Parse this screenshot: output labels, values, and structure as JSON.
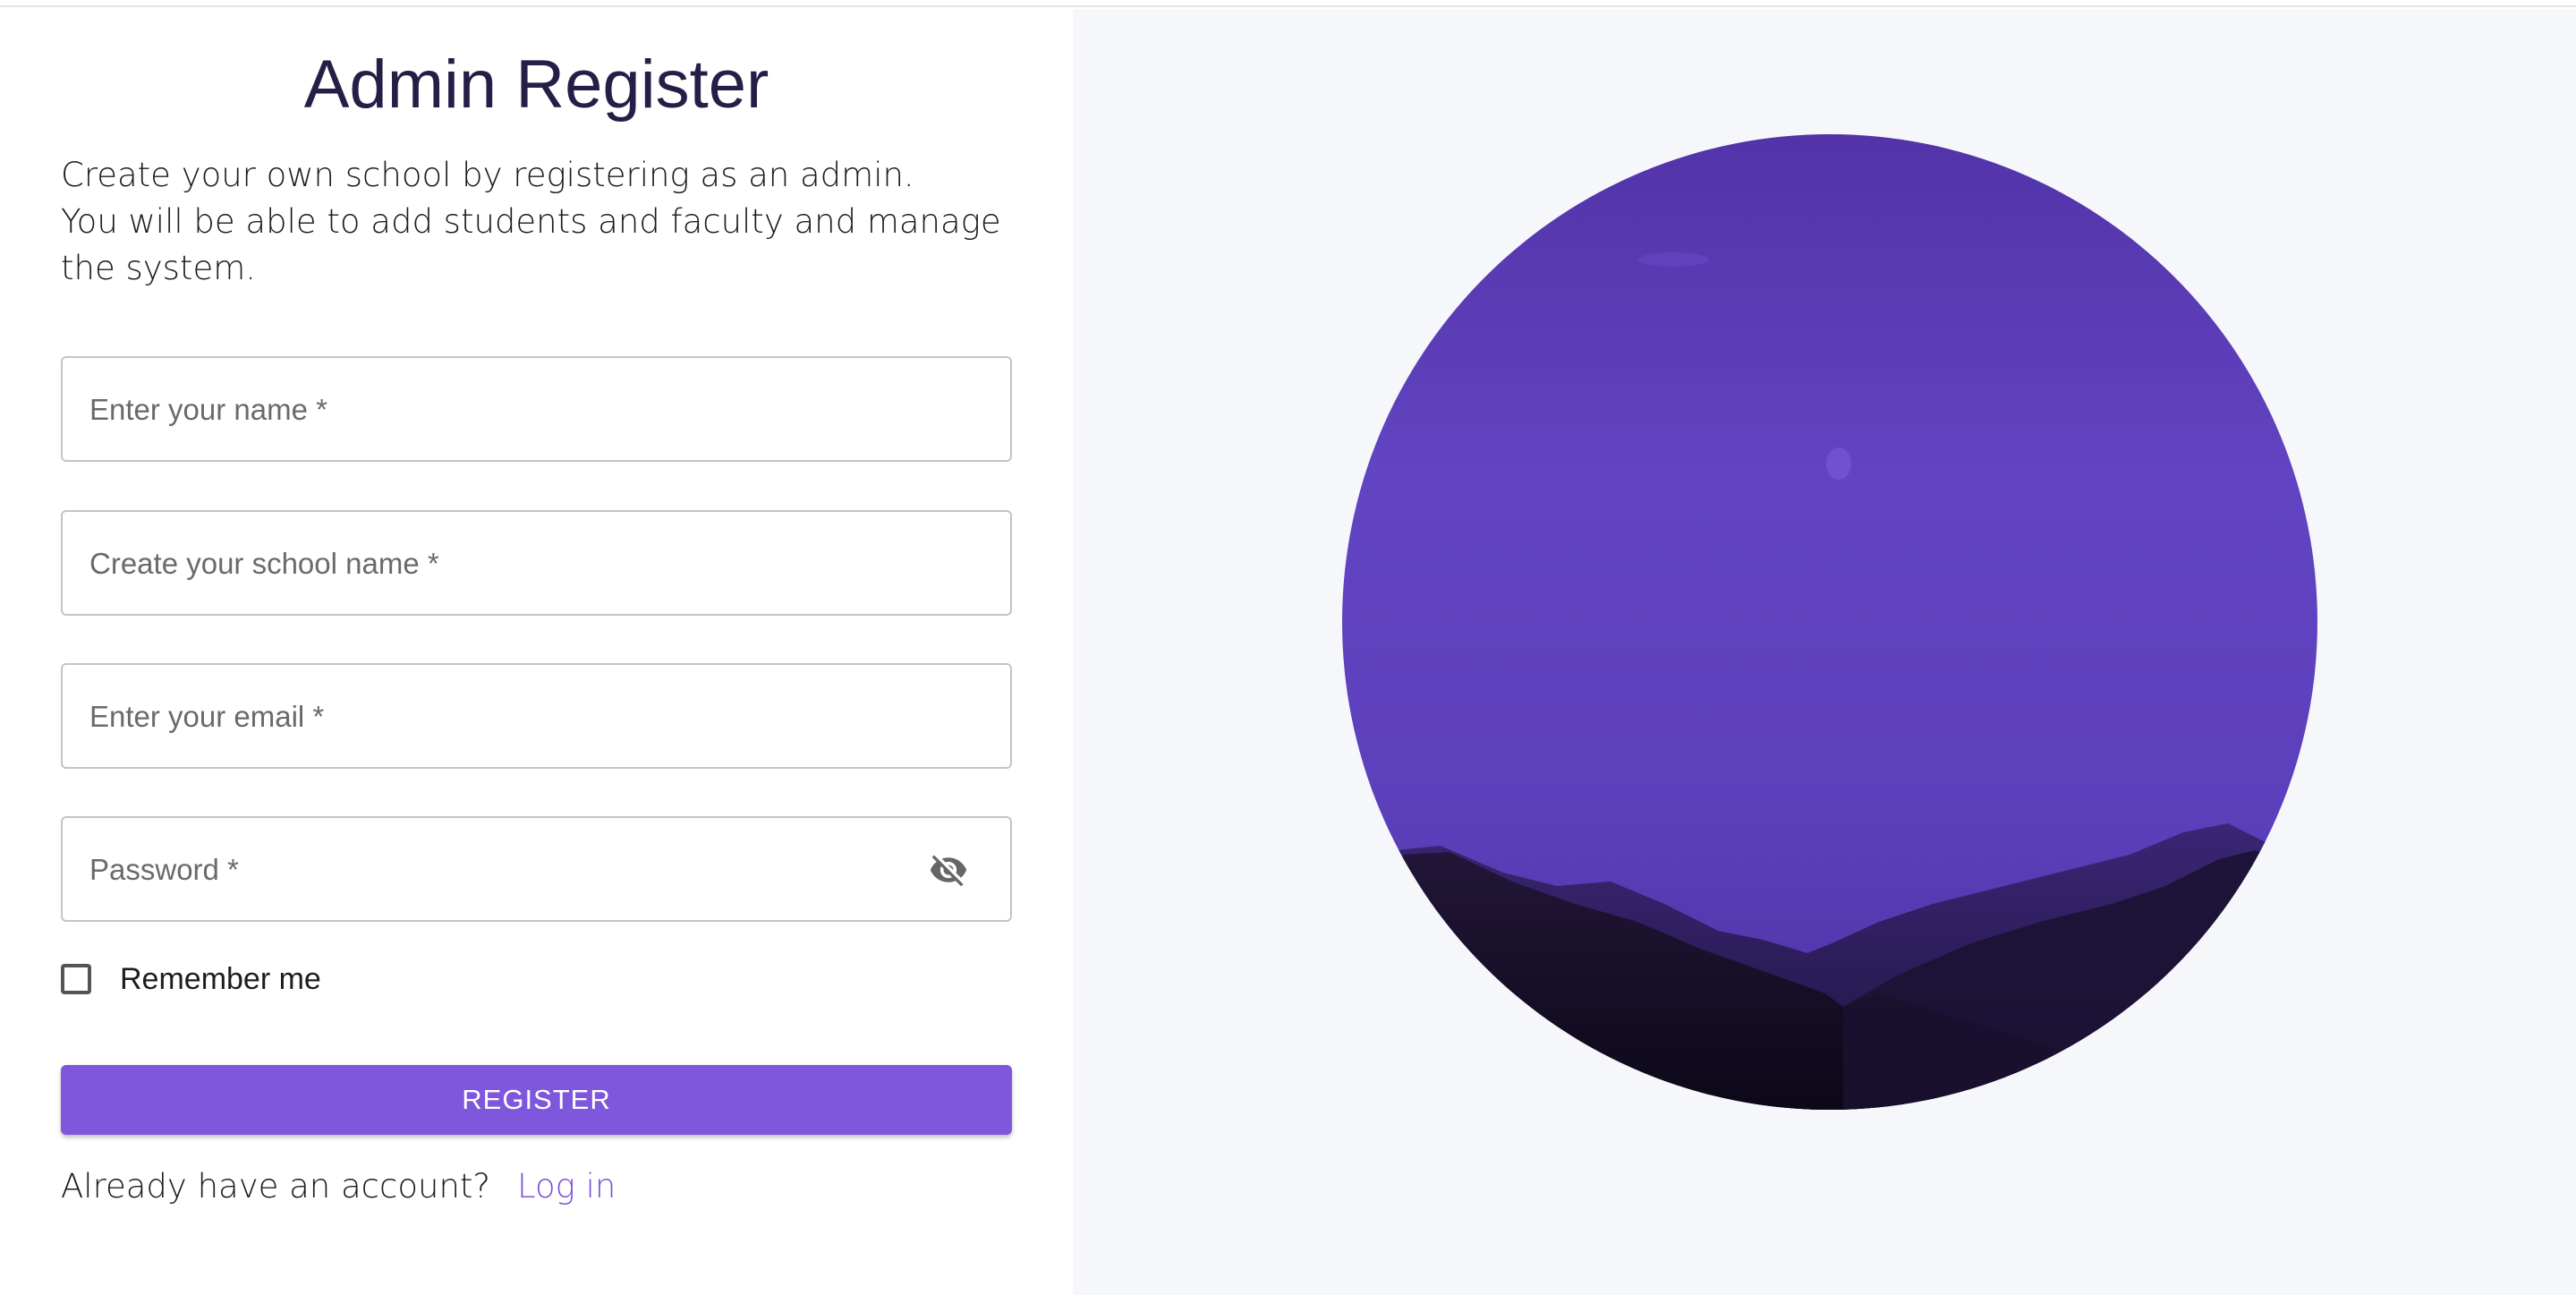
{
  "header": {
    "title": "Admin Register"
  },
  "description": {
    "line1": "Create your own school by registering as an admin.",
    "line2": "You will be able to add students and faculty and manage",
    "line3": "the system."
  },
  "form": {
    "name_placeholder": "Enter your name *",
    "school_placeholder": "Create your school name *",
    "email_placeholder": "Enter your email *",
    "password_placeholder": "Password *",
    "remember_label": "Remember me",
    "register_label": "REGISTER"
  },
  "footer": {
    "prompt": "Already have an account?",
    "login_label": "Log in"
  },
  "icons": {
    "password_toggle": "visibility-off-icon"
  },
  "colors": {
    "accent": "#7e57dc",
    "link": "#7a50d8",
    "title": "#251f47",
    "hero_sky": "#5f40bf",
    "right_background": "#f6f7fa"
  }
}
